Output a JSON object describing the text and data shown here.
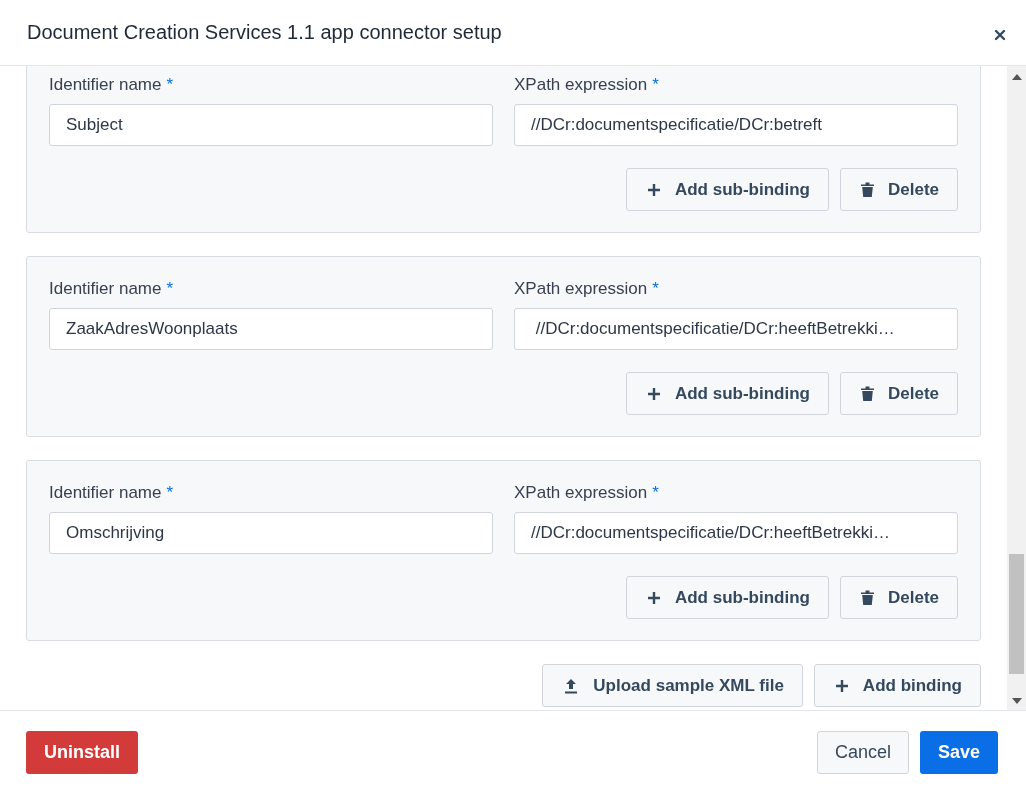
{
  "dialog": {
    "title": "Document Creation Services 1.1 app connector setup"
  },
  "bindings": [
    {
      "name_label": "Identifier name",
      "name_mark": "*",
      "name_value": "Subject",
      "xpath_label": "XPath expression",
      "xpath_mark": "*",
      "xpath_value": "//DCr:documentspecificatie/DCr:betreft",
      "add_label": "Add sub-binding",
      "delete_label": "Delete"
    },
    {
      "name_label": "Identifier name",
      "name_mark": "*",
      "name_value": "ZaakAdresWoonplaats",
      "xpath_label": "XPath expression",
      "xpath_mark": "*",
      "xpath_value": " //DCr:documentspecificatie/DCr:heeftBetrekki…",
      "add_label": "Add sub-binding",
      "delete_label": "Delete"
    },
    {
      "name_label": "Identifier name",
      "name_mark": "*",
      "name_value": "Omschrijving",
      "xpath_label": "XPath expression",
      "xpath_mark": "*",
      "xpath_value": "//DCr:documentspecificatie/DCr:heeftBetrekki…",
      "add_label": "Add sub-binding",
      "delete_label": "Delete"
    }
  ],
  "actions": {
    "upload": "Upload sample XML file",
    "add_binding": "Add binding"
  },
  "footer": {
    "uninstall": "Uninstall",
    "cancel": "Cancel",
    "save": "Save"
  }
}
